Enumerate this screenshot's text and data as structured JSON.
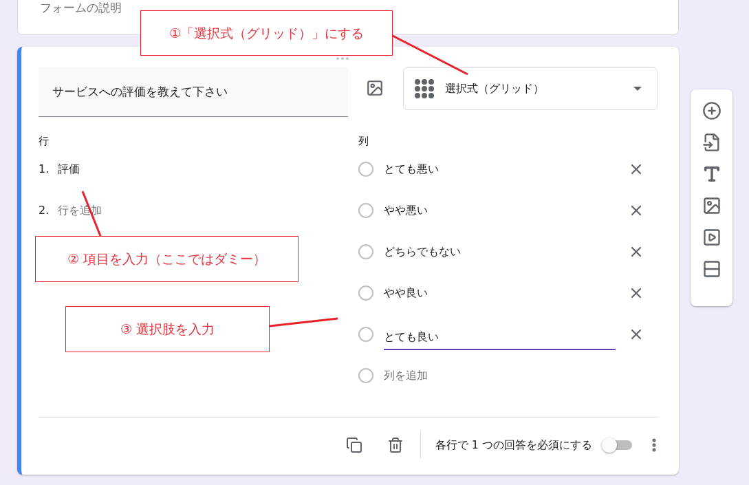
{
  "form_description_card": {
    "placeholder": "フォームの説明"
  },
  "question": {
    "title": "サービスへの評価を教えて下さい",
    "type": "選択式（グリッド）",
    "rows_label": "行",
    "rows": [
      {
        "number": "1.",
        "text": "評価",
        "kind": "item"
      },
      {
        "number": "2.",
        "text": "行を追加",
        "kind": "add"
      }
    ],
    "columns_label": "列",
    "columns": [
      {
        "text": "とても悪い",
        "kind": "item",
        "focused": false
      },
      {
        "text": "やや悪い",
        "kind": "item",
        "focused": false
      },
      {
        "text": "どちらでもない",
        "kind": "item",
        "focused": false
      },
      {
        "text": "やや良い",
        "kind": "item",
        "focused": false
      },
      {
        "text": "とても良い",
        "kind": "item",
        "focused": true
      },
      {
        "text": "列を追加",
        "kind": "add",
        "focused": false
      }
    ],
    "require_label": "各行で 1 つの回答を必須にする",
    "require_on": false
  },
  "annotations": [
    {
      "text": "①「選択式（グリッド）」にする"
    },
    {
      "text": "② 項目を入力（ここではダミー）"
    },
    {
      "text": "③ 選択肢を入力"
    }
  ]
}
